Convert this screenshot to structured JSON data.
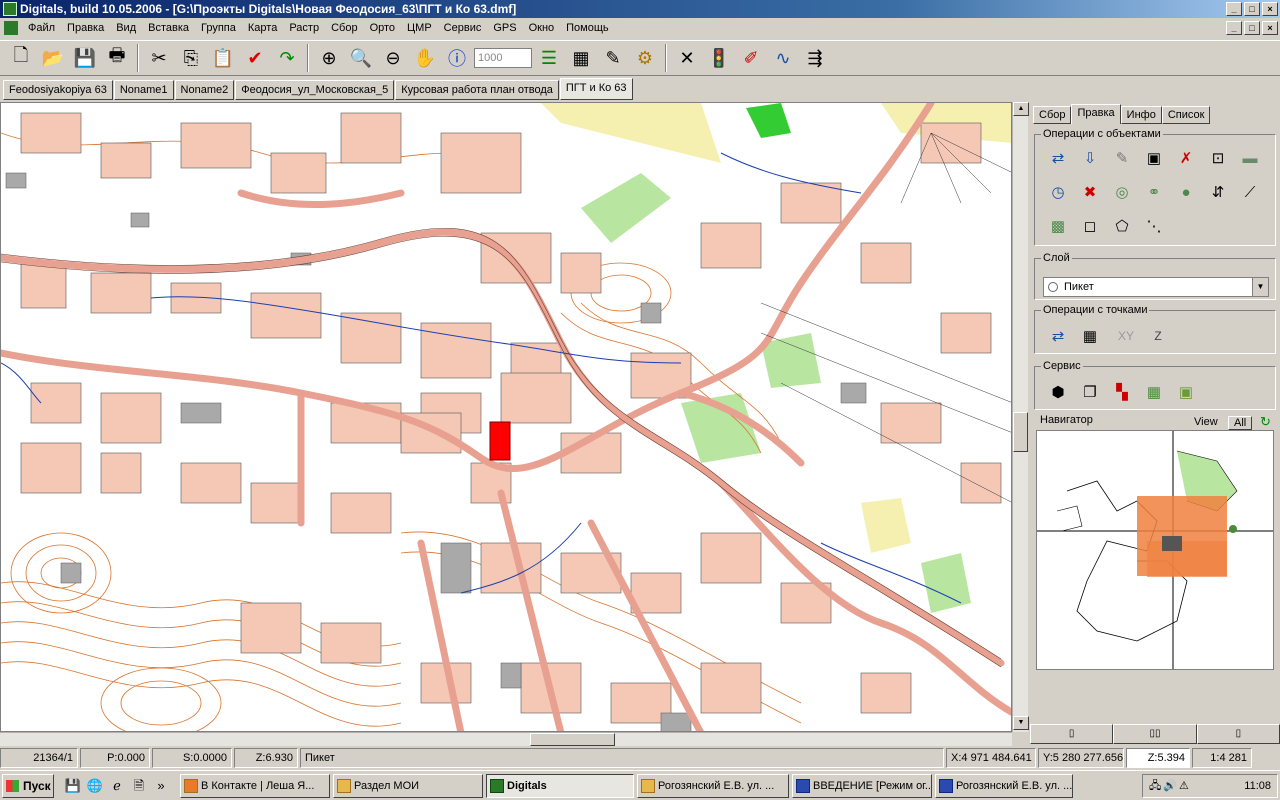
{
  "window": {
    "title": "Digitals, build 10.05.2006 - [G:\\Проэкты Digitals\\Новая Феодосия_63\\ПГТ и Ко 63.dmf]",
    "min": "_",
    "max": "□",
    "close": "×"
  },
  "menu": [
    "Файл",
    "Правка",
    "Вид",
    "Вставка",
    "Группа",
    "Карта",
    "Растр",
    "Сбор",
    "Орто",
    "ЦМР",
    "Сервис",
    "GPS",
    "Окно",
    "Помощь"
  ],
  "toolbar": {
    "scale_value": "1000",
    "icons": [
      "new-icon",
      "open-icon",
      "save-icon",
      "print-icon",
      "cut-icon",
      "copy-icon",
      "paste-icon",
      "check-icon",
      "redo-icon",
      "zoom-area-icon",
      "zoom-in-icon",
      "zoom-out-icon",
      "pan-hand-icon",
      "info-icon"
    ]
  },
  "doc_tabs": [
    "Feodosiyakopiya 63",
    "Noname1",
    "Noname2",
    "Феодосия_ул_Московская_5",
    "Курсовая работа план отвода",
    "ПГТ и Ко 63"
  ],
  "panel": {
    "tabs": [
      "Сбор",
      "Правка",
      "Инфо",
      "Список"
    ],
    "active_tab": "Правка",
    "groups": {
      "objects": "Операции с объектами",
      "layer": "Слой",
      "points": "Операции с точками",
      "service": "Сервис",
      "navigator": "Навигатор"
    },
    "layer_value": "Пикет",
    "points_labels": [
      "XY",
      "Z"
    ],
    "nav_view": "View",
    "nav_all": "All"
  },
  "status": {
    "obj_id": "21364/1",
    "p": "P:0.000",
    "s": "S:0.0000",
    "z": "Z:6.930",
    "layer": "Пикет",
    "x": "X:4 971 484.641",
    "y": "Y:5 280 277.656",
    "zz": "Z:5.394",
    "scale": "1:4 281"
  },
  "taskbar": {
    "start": "Пуск",
    "tasks": [
      "В Контакте | Леша Я...",
      "Раздел МОИ",
      "Digitals",
      "Рогозянский Е.В. ул. ...",
      "ВВЕДЕНИЕ [Режим ог...",
      "Рогозянский Е.В. ул. ..."
    ],
    "active_task": "Digitals",
    "clock": "11:08"
  },
  "colors": {
    "building": "#f5c7b5",
    "road": "#e8a090",
    "contour": "#d9732d",
    "green": "#b8e6a0",
    "yellow": "#f5f0b0",
    "highlight": "#ff0000",
    "navigator_orange": "#f08040"
  }
}
